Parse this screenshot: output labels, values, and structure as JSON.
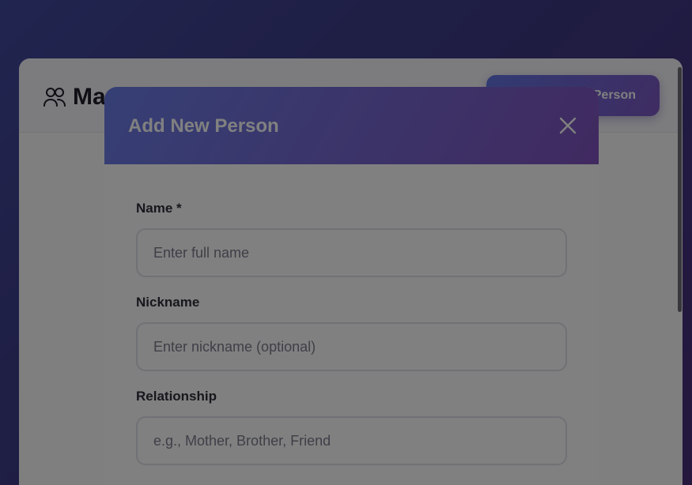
{
  "app": {
    "title": "Ma",
    "add_button_label": "Person"
  },
  "modal": {
    "title": "Add New Person",
    "fields": [
      {
        "label": "Name *",
        "placeholder": "Enter full name",
        "value": ""
      },
      {
        "label": "Nickname",
        "placeholder": "Enter nickname (optional)",
        "value": ""
      },
      {
        "label": "Relationship",
        "placeholder": "e.g., Mother, Brother, Friend",
        "value": ""
      }
    ]
  },
  "colors": {
    "accent_start": "#6b7ee8",
    "accent_end": "#8054c0",
    "background_start": "#414a9e",
    "background_end": "#4a2f7c"
  },
  "icons": {
    "app_icon": "people-icon",
    "close_icon": "close-icon"
  }
}
